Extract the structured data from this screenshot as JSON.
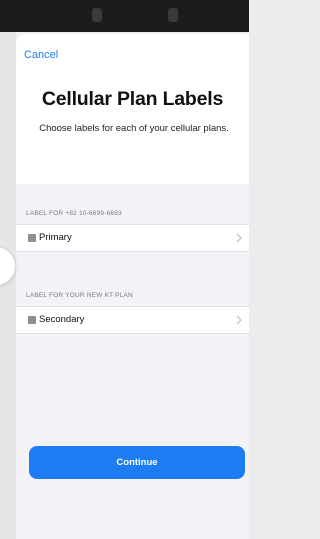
{
  "nav": {
    "cancel_label": "Cancel"
  },
  "header": {
    "title": "Cellular Plan Labels",
    "subtitle": "Choose labels for each of your cellular plans."
  },
  "plans": [
    {
      "section_label": "LABEL FOR +82 10-6699-6693",
      "label": "Primary",
      "icon": "sim-card-icon"
    },
    {
      "section_label": "LABEL FOR YOUR NEW KT PLAN",
      "label": "Secondary",
      "icon": "sim-card-icon"
    }
  ],
  "actions": {
    "continue_label": "Continue"
  },
  "colors": {
    "accent": "#1e7cf2",
    "background": "#f2f2f7",
    "status_bar": "#1c1c1e"
  }
}
